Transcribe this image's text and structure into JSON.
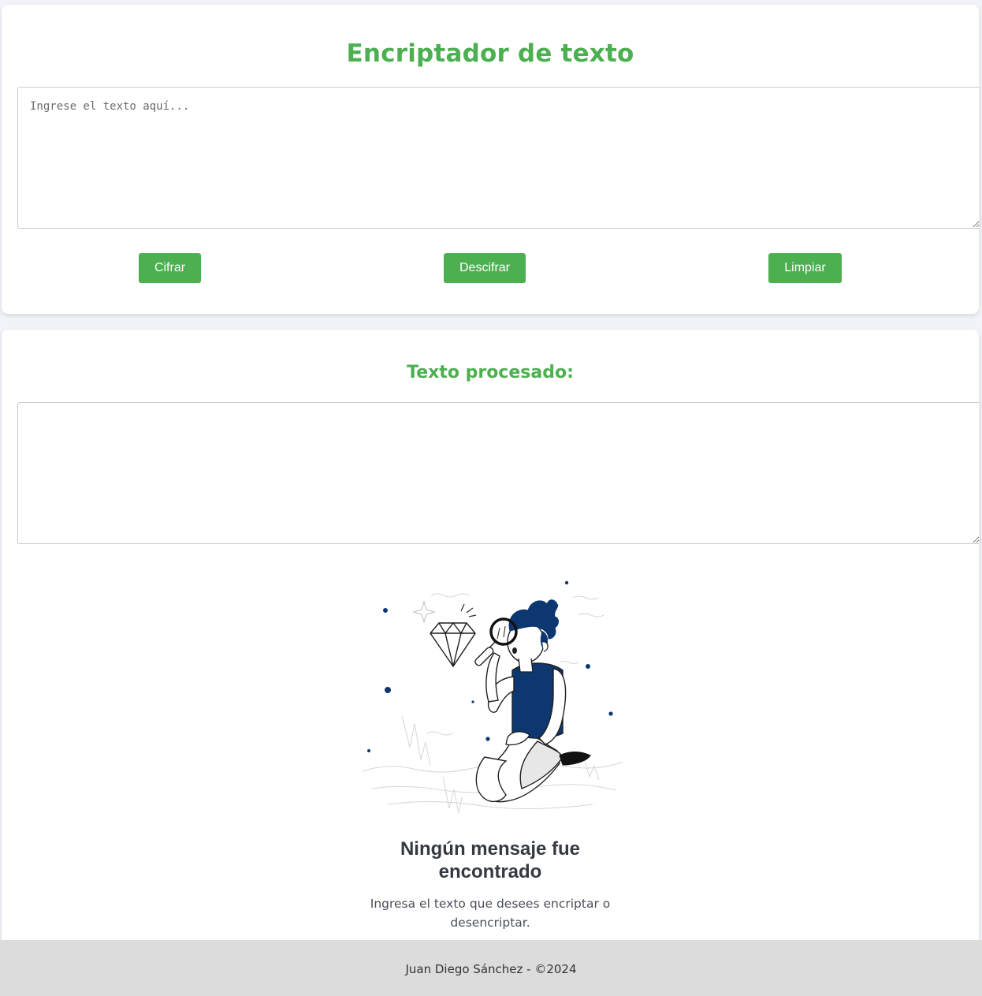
{
  "encrypt_card": {
    "title": "Encriptador de texto",
    "input_placeholder": "Ingrese el texto aquí...",
    "input_value": "",
    "buttons": {
      "encrypt": "Cifrar",
      "decrypt": "Descifrar",
      "clear": "Limpiar"
    }
  },
  "output_card": {
    "title": "Texto procesado:",
    "output_value": "",
    "illustration": "person-with-magnifying-glass-and-diamond",
    "empty_state": {
      "heading": "Ningún mensaje fue encontrado",
      "description": "Ingresa el texto que desees encriptar o desencriptar."
    }
  },
  "footer": {
    "text": "Juan Diego Sánchez - ©2024"
  },
  "colors": {
    "accent": "#4caf50",
    "illustration_blue": "#0d3770",
    "page_background": "#f1f3f8",
    "footer_background": "#dcdcdc"
  }
}
